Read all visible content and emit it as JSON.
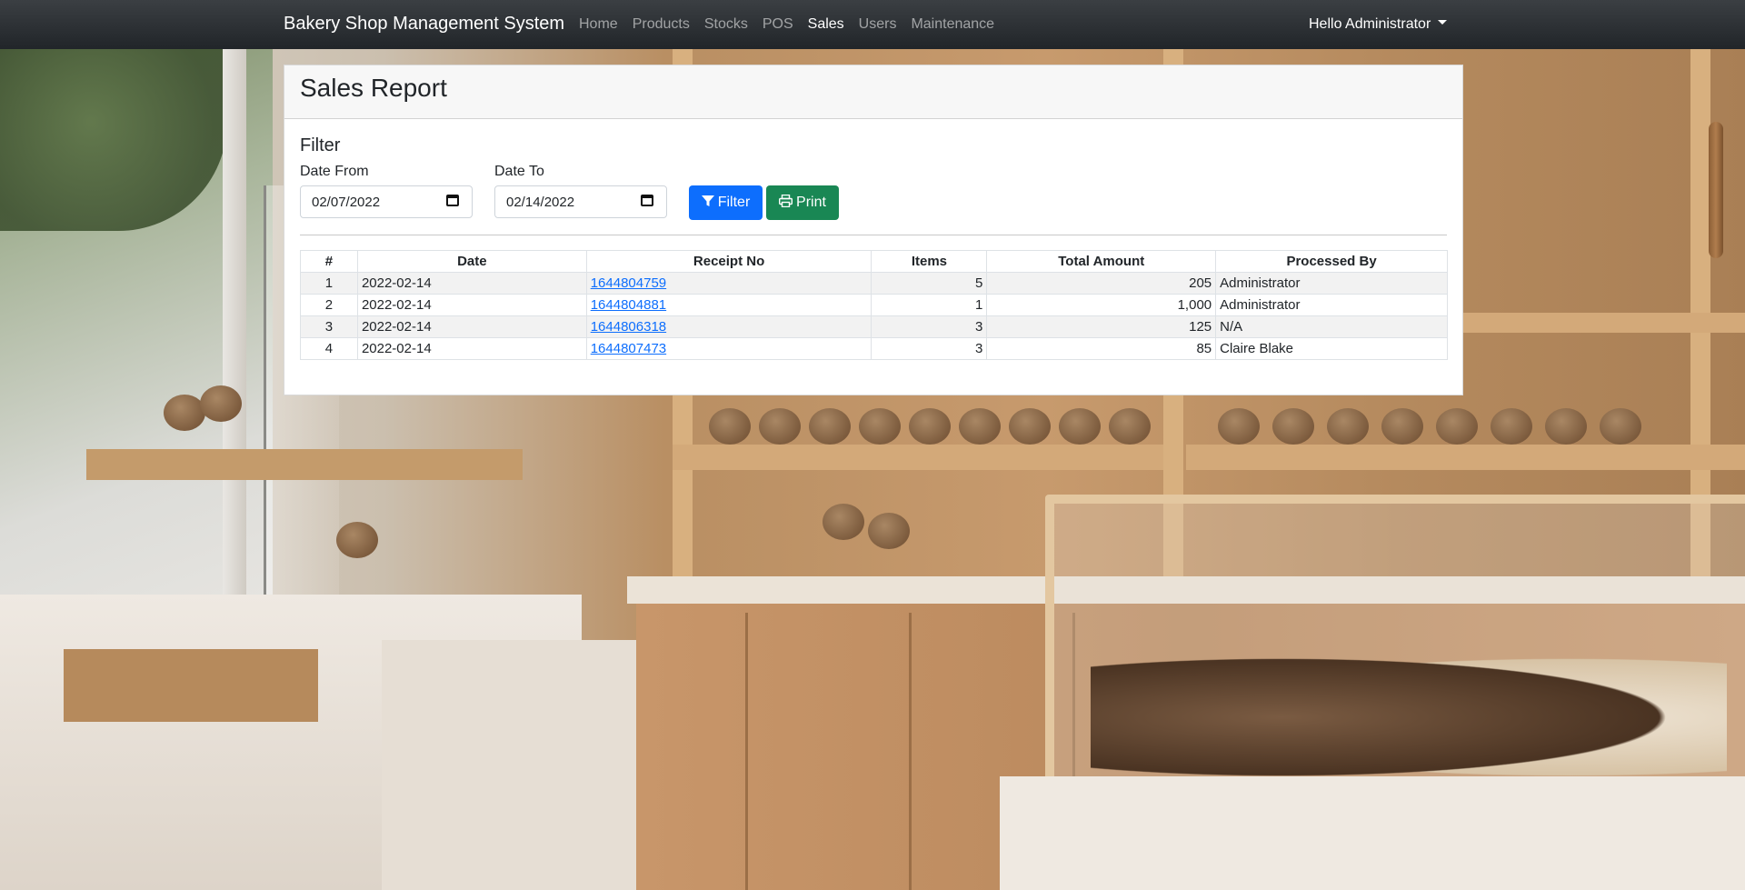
{
  "navbar": {
    "brand": "Bakery Shop Management System",
    "links": [
      "Home",
      "Products",
      "Stocks",
      "POS",
      "Sales",
      "Users",
      "Maintenance"
    ],
    "active": "Sales",
    "user_menu": "Hello Administrator"
  },
  "page": {
    "title": "Sales Report",
    "filter_heading": "Filter",
    "date_from_label": "Date From",
    "date_from_value": "02/07/2022",
    "date_to_label": "Date To",
    "date_to_value": "02/14/2022",
    "filter_button": "Filter",
    "print_button": "Print"
  },
  "table": {
    "headers": [
      "#",
      "Date",
      "Receipt No",
      "Items",
      "Total Amount",
      "Processed By"
    ],
    "rows": [
      {
        "num": "1",
        "date": "2022-02-14",
        "receipt": "1644804759",
        "items": "5",
        "total": "205",
        "by": "Administrator"
      },
      {
        "num": "2",
        "date": "2022-02-14",
        "receipt": "1644804881",
        "items": "1",
        "total": "1,000",
        "by": "Administrator"
      },
      {
        "num": "3",
        "date": "2022-02-14",
        "receipt": "1644806318",
        "items": "3",
        "total": "125",
        "by": "N/A"
      },
      {
        "num": "4",
        "date": "2022-02-14",
        "receipt": "1644807473",
        "items": "3",
        "total": "85",
        "by": "Claire Blake"
      }
    ]
  },
  "colors": {
    "navbar": "#212529",
    "primary": "#0d6efd",
    "success": "#198754"
  },
  "icons": {
    "filter": "filter-icon",
    "print": "print-icon",
    "calendar": "calendar-icon",
    "caret": "caret-down-icon"
  }
}
